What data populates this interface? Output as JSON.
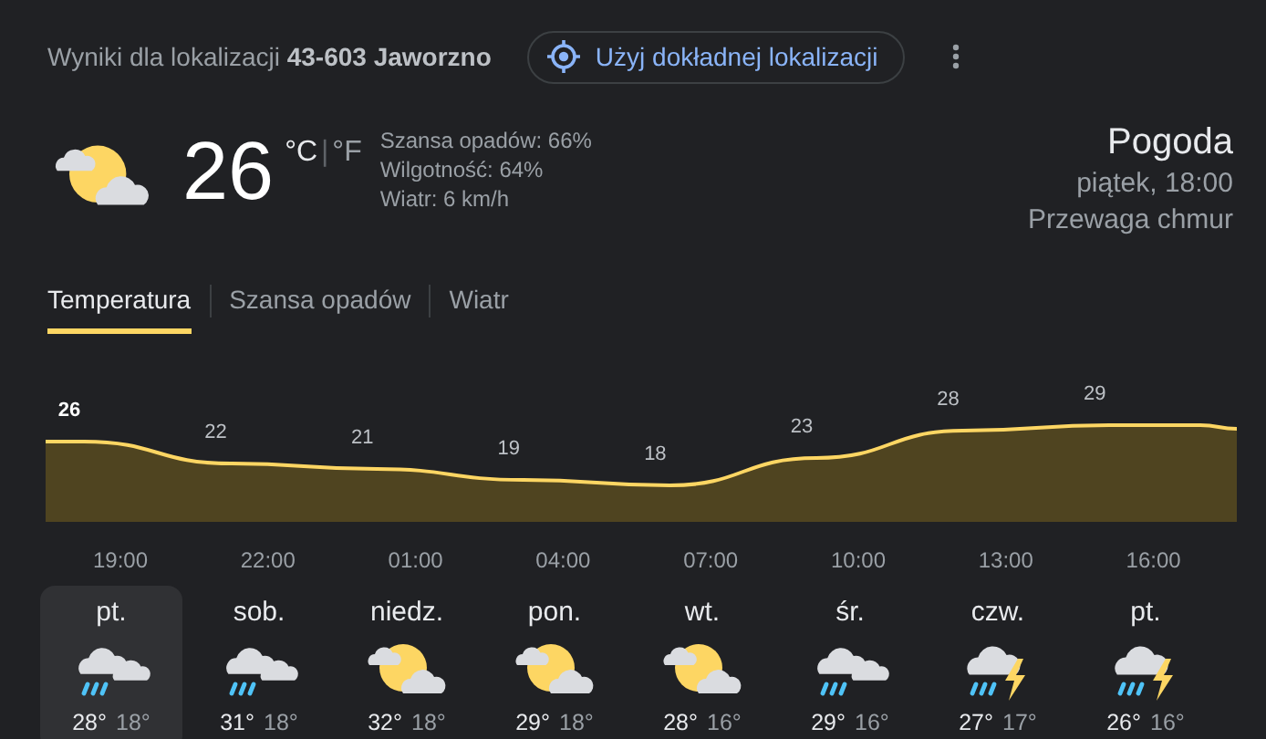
{
  "header": {
    "location_text": "Wyniki dla lokalizacji **43-603 Jaworzno**",
    "precise_button": "Użyj dokładnej lokalizacji"
  },
  "current": {
    "temperature": "26",
    "units": [
      {
        "label": "°C",
        "selected": true
      },
      {
        "label": "°F",
        "selected": false
      }
    ],
    "unit_sep": "|",
    "details": [
      "Szansa opadów: 66%",
      "Wilgotność: 64%",
      "Wiatr: 6 km/h"
    ],
    "title": "Pogoda",
    "time": "piątek, 18:00",
    "description": "Przewaga chmur"
  },
  "tabs": [
    {
      "label": "Temperatura",
      "selected": true
    },
    {
      "label": "Szansa opadów",
      "selected": false
    },
    {
      "label": "Wiatr",
      "selected": false
    }
  ],
  "temperature_graph": {
    "labels": [
      "26",
      "22",
      "21",
      "19",
      "18",
      "23",
      "28",
      "29"
    ],
    "times": [
      "19:00",
      "22:00",
      "01:00",
      "04:00",
      "07:00",
      "10:00",
      "13:00",
      "16:00"
    ]
  },
  "days": [
    {
      "day": "pt.",
      "kind": "rain",
      "high": "28°",
      "low": "18°",
      "selected": true
    },
    {
      "day": "sob.",
      "kind": "rain",
      "high": "31°",
      "low": "18°",
      "selected": false
    },
    {
      "day": "niedz.",
      "kind": "partly-cloudy",
      "high": "32°",
      "low": "18°",
      "selected": false
    },
    {
      "day": "pon.",
      "kind": "partly-cloudy",
      "high": "29°",
      "low": "18°",
      "selected": false
    },
    {
      "day": "wt.",
      "kind": "partly-cloudy",
      "high": "28°",
      "low": "16°",
      "selected": false
    },
    {
      "day": "śr.",
      "kind": "rain",
      "high": "29°",
      "low": "16°",
      "selected": false
    },
    {
      "day": "czw.",
      "kind": "storm",
      "high": "27°",
      "low": "17°",
      "selected": false
    },
    {
      "day": "pt.",
      "kind": "storm",
      "high": "26°",
      "low": "16°",
      "selected": false
    }
  ]
}
